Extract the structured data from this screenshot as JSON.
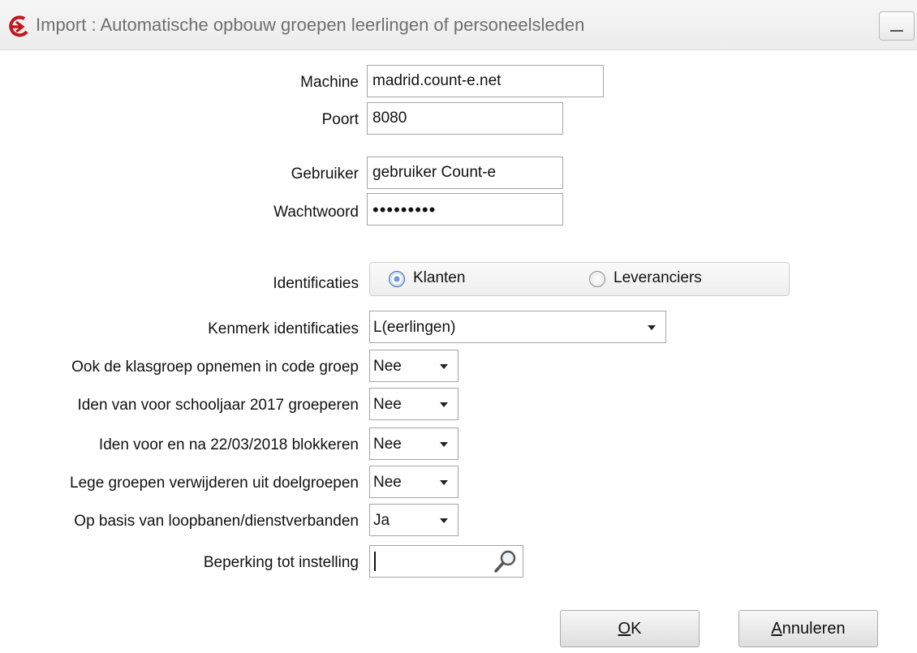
{
  "window": {
    "title": "Import : Automatische opbouw groepen leerlingen of personeelsleden",
    "minimize_icon": "minimize-icon",
    "app_icon": "count-e-logo-icon"
  },
  "form": {
    "machine": {
      "label": "Machine",
      "value": "madrid.count-e.net"
    },
    "poort": {
      "label": "Poort",
      "value": "8080"
    },
    "gebruiker": {
      "label": "Gebruiker",
      "value": "gebruiker Count-e"
    },
    "wachtwoord": {
      "label": "Wachtwoord",
      "masked": "•••••••••"
    },
    "identificaties": {
      "label": "Identificaties",
      "options": [
        "Klanten",
        "Leveranciers"
      ],
      "selected": "Klanten"
    },
    "kenmerk": {
      "label": "Kenmerk identificaties",
      "value": "L(eerlingen)"
    },
    "klasgroep": {
      "label": "Ook de klasgroep opnemen in code groep",
      "value": "Nee"
    },
    "schooljaar": {
      "label": "Iden van voor schooljaar 2017 groeperen",
      "value": "Nee"
    },
    "blokkeren": {
      "label": "Iden voor en na 22/03/2018 blokkeren",
      "value": "Nee"
    },
    "lege_groepen": {
      "label": "Lege groepen verwijderen uit doelgroepen",
      "value": "Nee"
    },
    "loopbanen": {
      "label": "Op basis van loopbanen/dienstverbanden",
      "value": "Ja"
    },
    "beperking": {
      "label": "Beperking tot instelling",
      "value": ""
    }
  },
  "buttons": {
    "ok": {
      "accel": "O",
      "rest": "K"
    },
    "annuleren": {
      "accel": "A",
      "rest": "nnuleren"
    }
  },
  "colors": {
    "accent": "#3e6fb5",
    "logo": "#c0161c"
  }
}
